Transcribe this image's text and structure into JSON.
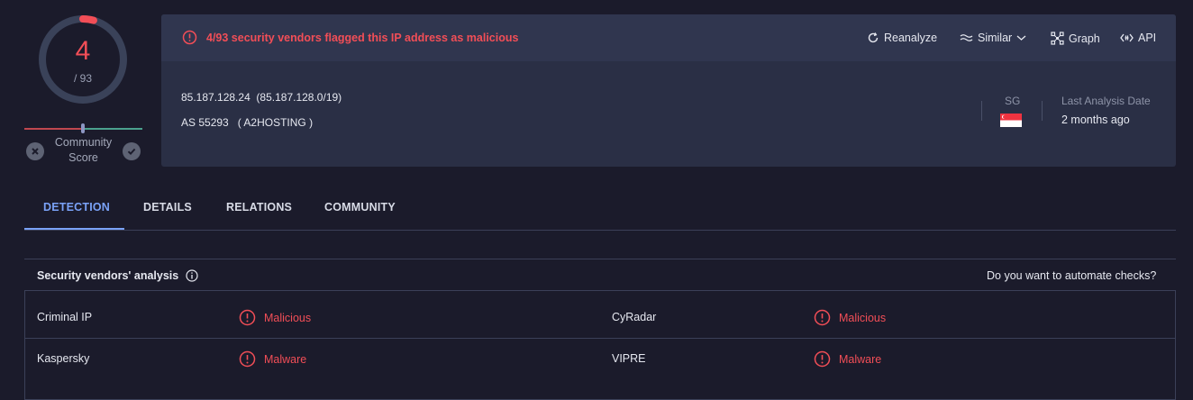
{
  "score": {
    "detections": "4",
    "total": "/ 93",
    "ratio": 0.043
  },
  "community": {
    "label": "Community Score",
    "value": 0
  },
  "card": {
    "alert": "4/93 security vendors flagged this IP address as malicious",
    "actions": {
      "reanalyze": "Reanalyze",
      "similar": "Similar",
      "graph": "Graph",
      "api": "API"
    },
    "ip": "85.187.128.24",
    "network": "(85.187.128.0/19)",
    "as_number": "AS 55293",
    "as_owner": "( A2HOSTING )",
    "country": "SG",
    "last_analysis_label": "Last Analysis Date",
    "last_analysis_value": "2 months ago"
  },
  "tabs": [
    "DETECTION",
    "DETAILS",
    "RELATIONS",
    "COMMUNITY"
  ],
  "vendors": {
    "title": "Security vendors' analysis",
    "automate": "Do you want to automate checks?",
    "rows": [
      [
        {
          "name": "Criminal IP",
          "result": "Malicious"
        },
        {
          "name": "CyRadar",
          "result": "Malicious"
        }
      ],
      [
        {
          "name": "Kaspersky",
          "result": "Malware"
        },
        {
          "name": "VIPRE",
          "result": "Malware"
        }
      ]
    ]
  },
  "colors": {
    "malicious": "#f24e57",
    "accent": "#7aa2f7",
    "background": "#1b1b2b"
  }
}
